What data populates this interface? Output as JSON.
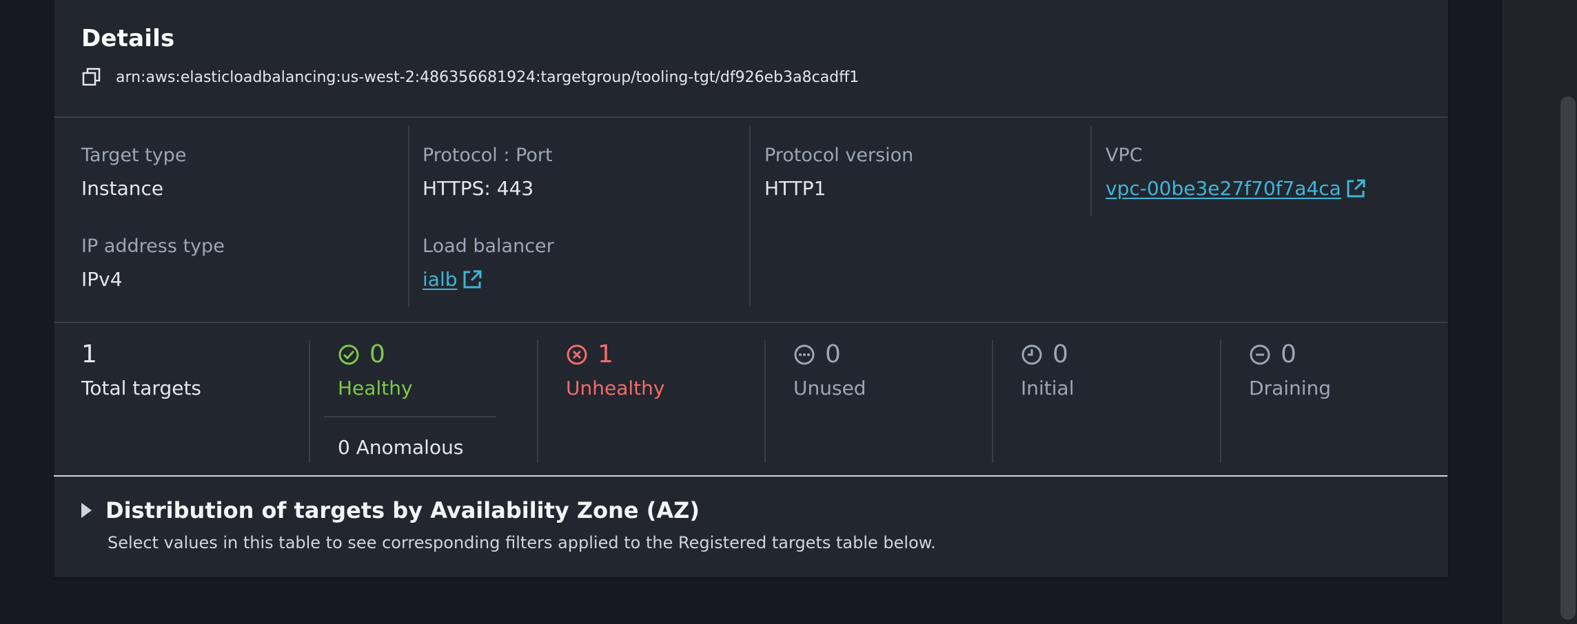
{
  "details": {
    "title": "Details",
    "arn": "arn:aws:elasticloadbalancing:us-west-2:486356681924:targetgroup/tooling-tgt/df926eb3a8cadff1"
  },
  "attributes": {
    "target_type": {
      "label": "Target type",
      "value": "Instance"
    },
    "protocol_port": {
      "label": "Protocol : Port",
      "value": "HTTPS: 443"
    },
    "protocol_version": {
      "label": "Protocol version",
      "value": "HTTP1"
    },
    "vpc": {
      "label": "VPC",
      "value": "vpc-00be3e27f70f7a4ca"
    },
    "ip_address_type": {
      "label": "IP address type",
      "value": "IPv4"
    },
    "load_balancer": {
      "label": "Load balancer",
      "value": "ialb"
    }
  },
  "stats": {
    "total": {
      "count": "1",
      "label": "Total targets"
    },
    "healthy": {
      "count": "0",
      "label": "Healthy",
      "color": "#7dc94a"
    },
    "anomalous": {
      "text": "0 Anomalous"
    },
    "unhealthy": {
      "count": "1",
      "label": "Unhealthy",
      "color": "#f16c6c"
    },
    "unused": {
      "count": "0",
      "label": "Unused",
      "color": "#9ba7b6"
    },
    "initial": {
      "count": "0",
      "label": "Initial",
      "color": "#9ba7b6"
    },
    "draining": {
      "count": "0",
      "label": "Draining",
      "color": "#9ba7b6"
    }
  },
  "distribution": {
    "title": "Distribution of targets by Availability Zone (AZ)",
    "description": "Select values in this table to see corresponding filters applied to the Registered targets table below."
  },
  "colors": {
    "background": "#16191f",
    "panel": "#22262e",
    "link": "#3fb6d8",
    "healthy": "#7dc94a",
    "unhealthy": "#f16c6c",
    "muted": "#9ba7b6"
  },
  "icons": [
    "copy-icon",
    "external-link-icon",
    "check-circle-icon",
    "x-circle-icon",
    "ellipsis-circle-icon",
    "clock-icon",
    "minus-circle-icon",
    "caret-right-icon"
  ]
}
